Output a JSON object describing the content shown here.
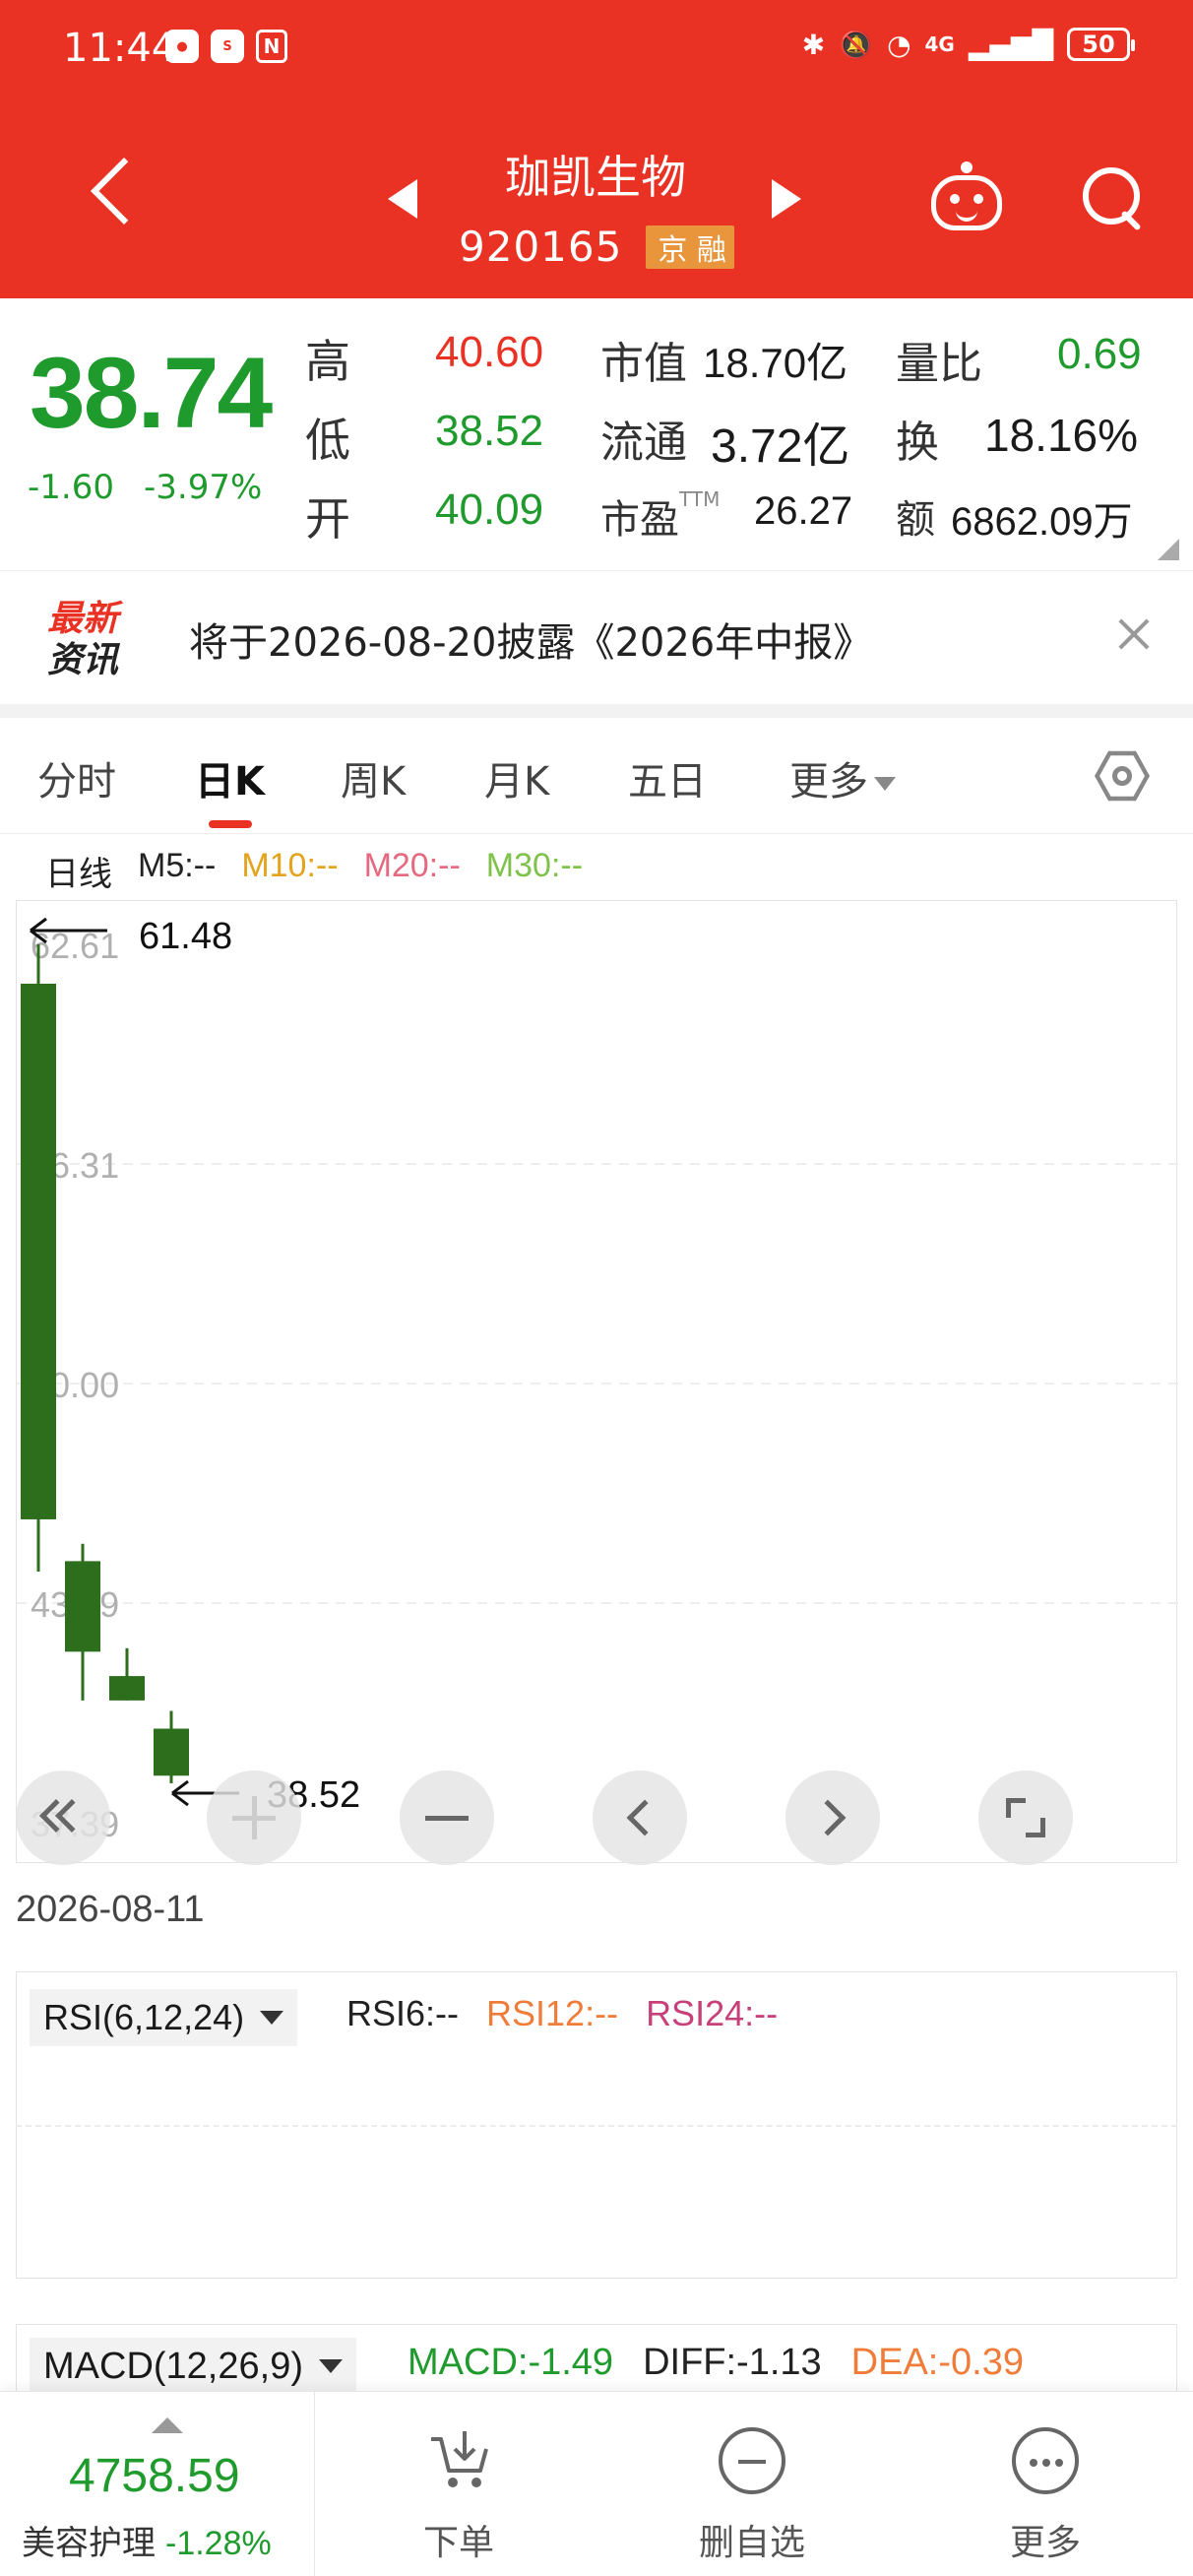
{
  "status_bar": {
    "time": "11:44",
    "battery": "50",
    "network": "4G"
  },
  "header": {
    "stock_name": "珈凯生物",
    "stock_code": "920165",
    "market_tag": "京 融"
  },
  "quote": {
    "price": "38.74",
    "change": "-1.60",
    "change_pct": "-3.97%",
    "high_label": "高",
    "high_value": "40.60",
    "low_label": "低",
    "low_value": "38.52",
    "open_label": "开",
    "open_value": "40.09",
    "mktcap_label": "市值",
    "mktcap_value": "18.70亿",
    "float_label": "流通",
    "float_value": "3.72亿",
    "pe_label": "市盈",
    "pe_suffix": "TTM",
    "pe_value": "26.27",
    "volratio_label": "量比",
    "volratio_value": "0.69",
    "turnover_label": "换",
    "turnover_value": "18.16%",
    "amount_label": "额",
    "amount_value": "6862.09万"
  },
  "news": {
    "logo_line1": "最新",
    "logo_line2": "资讯",
    "text": "将于2026-08-20披露《2026年中报》"
  },
  "tabs": [
    {
      "label": "分时"
    },
    {
      "label": "日K"
    },
    {
      "label": "周K"
    },
    {
      "label": "月K"
    },
    {
      "label": "五日"
    },
    {
      "label": "更多"
    }
  ],
  "ma_legend": {
    "title": "日线",
    "m5": "M5:--",
    "m10": "M10:--",
    "m20": "M20:--",
    "m30": "M30:--"
  },
  "colors": {
    "brand_red": "#e93224",
    "down_green": "#1f9a2c",
    "candle_green": "#2c6e1c",
    "m10": "#e3a31c",
    "m20": "#e56a7f",
    "m30": "#7fc24a"
  },
  "chart_data": {
    "type": "candlestick",
    "y_ticks": [
      "62.61",
      "56.31",
      "50.00",
      "43.69",
      "37.39"
    ],
    "ylim": [
      37.39,
      62.61
    ],
    "max_label": "61.48",
    "min_label": "38.52",
    "candles": [
      {
        "open": 61.48,
        "close": 46.1,
        "high": 62.61,
        "low": 44.6
      },
      {
        "open": 44.9,
        "close": 42.3,
        "high": 45.4,
        "low": 40.9
      },
      {
        "open": 41.6,
        "close": 40.9,
        "high": 42.4,
        "low": 40.9
      },
      {
        "open": 40.09,
        "close": 38.74,
        "high": 40.6,
        "low": 38.52
      }
    ],
    "current_date": "2026-08-11"
  },
  "rsi": {
    "selector": "RSI(6,12,24)",
    "rsi6": "RSI6:--",
    "rsi12": "RSI12:--",
    "rsi24": "RSI24:--"
  },
  "macd": {
    "selector": "MACD(12,26,9)",
    "macd": "MACD:-1.49",
    "diff": "DIFF:-1.13",
    "dea": "DEA:-0.39"
  },
  "bottom": {
    "index_value": "4758.59",
    "index_name": "美容护理",
    "index_change": "-1.28%",
    "order_label": "下单",
    "remove_label": "删自选",
    "more_label": "更多"
  }
}
